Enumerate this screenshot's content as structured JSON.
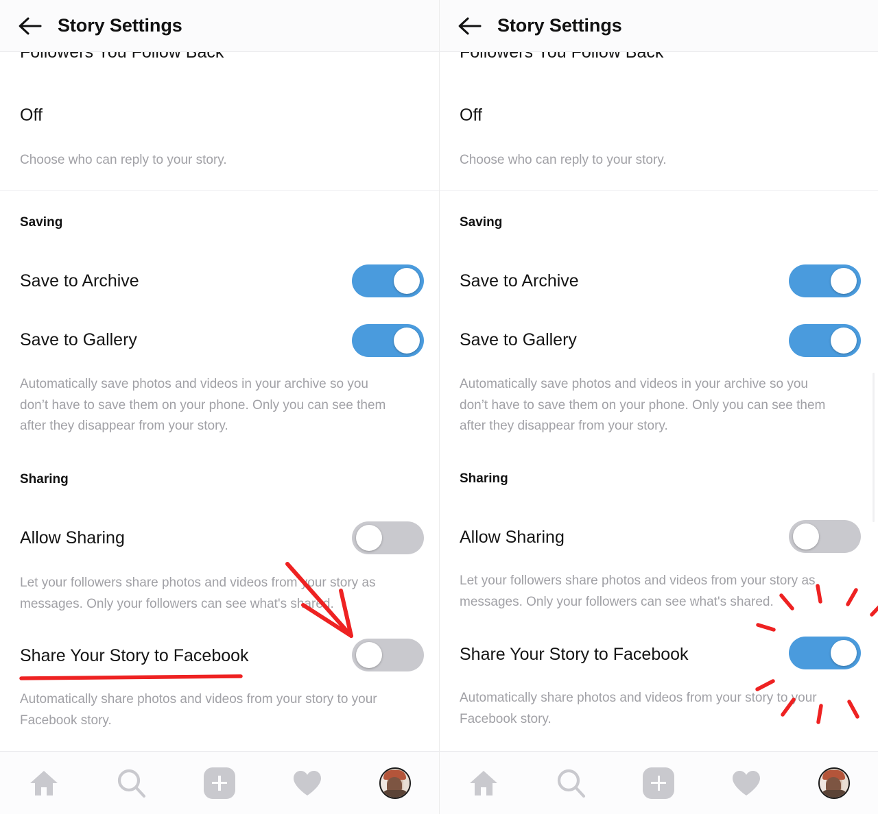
{
  "app": {
    "screen_title": "Story Settings",
    "back_icon": "back-arrow-icon"
  },
  "panels": [
    {
      "id": "before",
      "clipped_row_label": "Followers You Follow Back",
      "reply_value": "Off",
      "reply_hint": "Choose who can reply to your story.",
      "saving": {
        "heading": "Saving",
        "rows": [
          {
            "label": "Save to Archive",
            "state": "on"
          },
          {
            "label": "Save to Gallery",
            "state": "on"
          }
        ],
        "description": "Automatically save photos and videos in your archive so you don’t have to save them on your phone. Only you can see them after they disappear from your story."
      },
      "sharing": {
        "heading": "Sharing",
        "allow_sharing": {
          "label": "Allow Sharing",
          "state": "off"
        },
        "allow_sharing_description": "Let your followers share photos and videos from your story as messages. Only your followers can see what's shared.",
        "facebook": {
          "label": "Share Your Story to Facebook",
          "state": "off"
        },
        "facebook_description": "Automatically share photos and videos from your story to your Facebook story."
      },
      "annotations": [
        "red-arrow-pointing-to-facebook-toggle",
        "red-underline-under-facebook-label"
      ]
    },
    {
      "id": "after",
      "clipped_row_label": "Followers You Follow Back",
      "reply_value": "Off",
      "reply_hint": "Choose who can reply to your story.",
      "saving": {
        "heading": "Saving",
        "rows": [
          {
            "label": "Save to Archive",
            "state": "on"
          },
          {
            "label": "Save to Gallery",
            "state": "on"
          }
        ],
        "description": "Automatically save photos and videos in your archive so you don’t have to save them on your phone. Only you can see them after they disappear from your story."
      },
      "sharing": {
        "heading": "Sharing",
        "allow_sharing": {
          "label": "Allow Sharing",
          "state": "off"
        },
        "allow_sharing_description": "Let your followers share photos and videos from your story as messages. Only your followers can see what's shared.",
        "facebook": {
          "label": "Share Your Story to Facebook",
          "state": "on"
        },
        "facebook_description": "Automatically share photos and videos from your story to your Facebook story."
      },
      "annotations": [
        "red-starburst-around-facebook-toggle"
      ]
    }
  ],
  "bottom_nav": {
    "items": [
      {
        "name": "home-icon",
        "label": "Home"
      },
      {
        "name": "search-icon",
        "label": "Search"
      },
      {
        "name": "add-post-icon",
        "label": "New Post"
      },
      {
        "name": "heart-icon",
        "label": "Activity"
      },
      {
        "name": "profile-avatar",
        "label": "Profile"
      }
    ]
  },
  "colors": {
    "toggle_on": "#4a9bdd",
    "toggle_off": "#c9c9ce",
    "annotation_red": "#ee2222",
    "header_bg": "#fbfbfc",
    "text_primary": "#151515",
    "text_secondary": "#a1a1a6"
  }
}
